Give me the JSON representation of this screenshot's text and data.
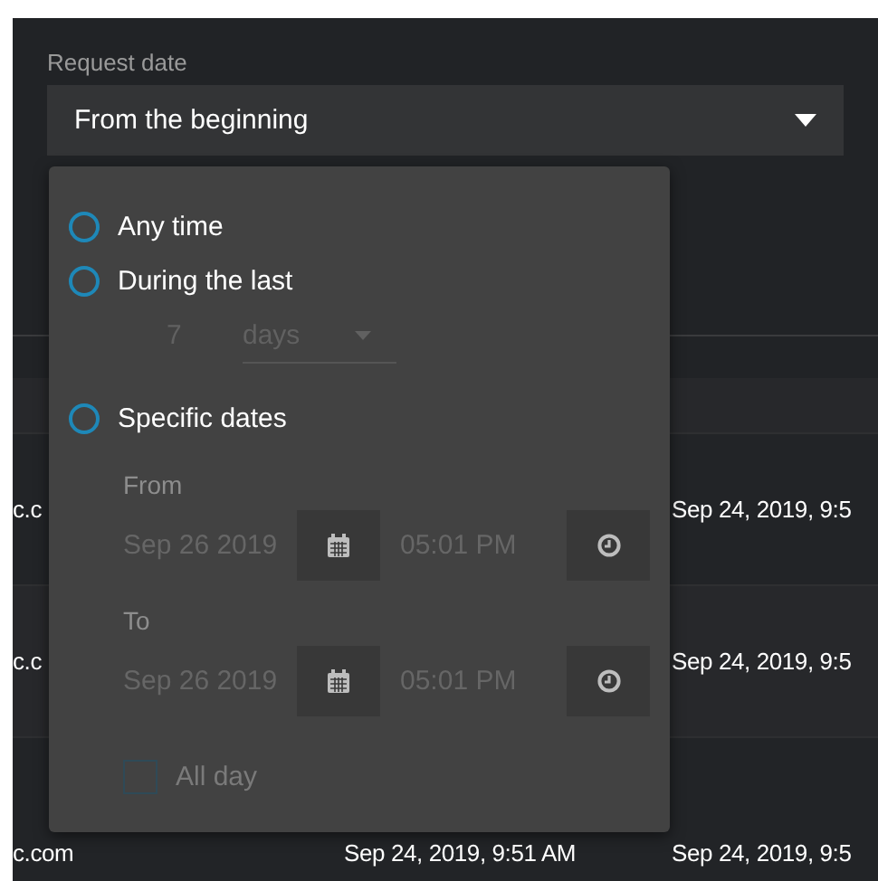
{
  "filter": {
    "label": "Request date",
    "value": "From the beginning"
  },
  "table": {
    "rows": [
      {
        "cells": [
          "c.c",
          null,
          "Sep 24, 2019, 9:5"
        ]
      },
      {
        "cells": [
          "c.c",
          null,
          "Sep 24, 2019, 9:5"
        ]
      },
      {
        "cells": [
          "c.com",
          "Sep 24, 2019, 9:51 AM",
          "Sep 24, 2019, 9:5"
        ]
      }
    ]
  },
  "menu": {
    "options": [
      {
        "label": "Any time",
        "selected": false
      },
      {
        "label": "During the last",
        "selected": false
      },
      {
        "label": "Specific dates",
        "selected": false
      }
    ],
    "during_the_last": {
      "amount": "7",
      "unit": "days",
      "disabled": true
    },
    "specific_dates": {
      "disabled": true,
      "ranges": [
        {
          "label": "From",
          "date": "Sep 26 2019",
          "time": "05:01 PM"
        },
        {
          "label": "To",
          "date": "Sep 26 2019",
          "time": "05:01 PM"
        }
      ],
      "all_day": {
        "label": "All day",
        "checked": false
      }
    }
  }
}
